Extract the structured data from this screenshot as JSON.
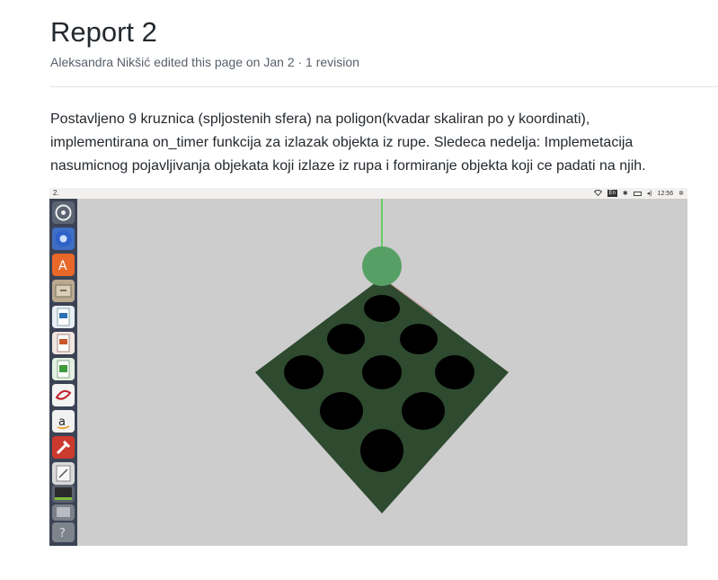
{
  "page": {
    "title": "Report 2",
    "meta": "Aleksandra Nikšić edited this page on Jan 2 · 1 revision",
    "description": "Postavljeno 9 kruznica (spljostenih sfera) na poligon(kvadar skaliran po y koordinati), implementirana on_timer funkcija za izlazak objekta iz rupe. Sledeca nedelja: Implemetacija nasumicnog pojavljivanja objekata koji izlaze iz rupa i formiranje objekta koji ce padati na njih."
  },
  "screenshot": {
    "window_title": "2.",
    "tray": {
      "keyboard": "En",
      "clock": "12:56",
      "icons": [
        "wifi-icon",
        "keyboard-layout-icon",
        "bluetooth-icon",
        "battery-icon",
        "volume-icon",
        "settings-gear-icon"
      ]
    },
    "launcher_icons": [
      "ubuntu-dash-icon",
      "chromium-icon",
      "software-center-icon",
      "files-icon",
      "writer-icon",
      "impress-icon",
      "calc-icon",
      "libreoffice-icon",
      "amazon-icon",
      "system-settings-icon",
      "text-editor-icon",
      "terminal-icon",
      "app-icon",
      "help-icon"
    ],
    "scene": {
      "board_color": "#2e4a2f",
      "hole_color": "#000000",
      "ball_color": "#57a065",
      "pole_color": "#00cc00",
      "background": "#cdcdcd"
    }
  }
}
